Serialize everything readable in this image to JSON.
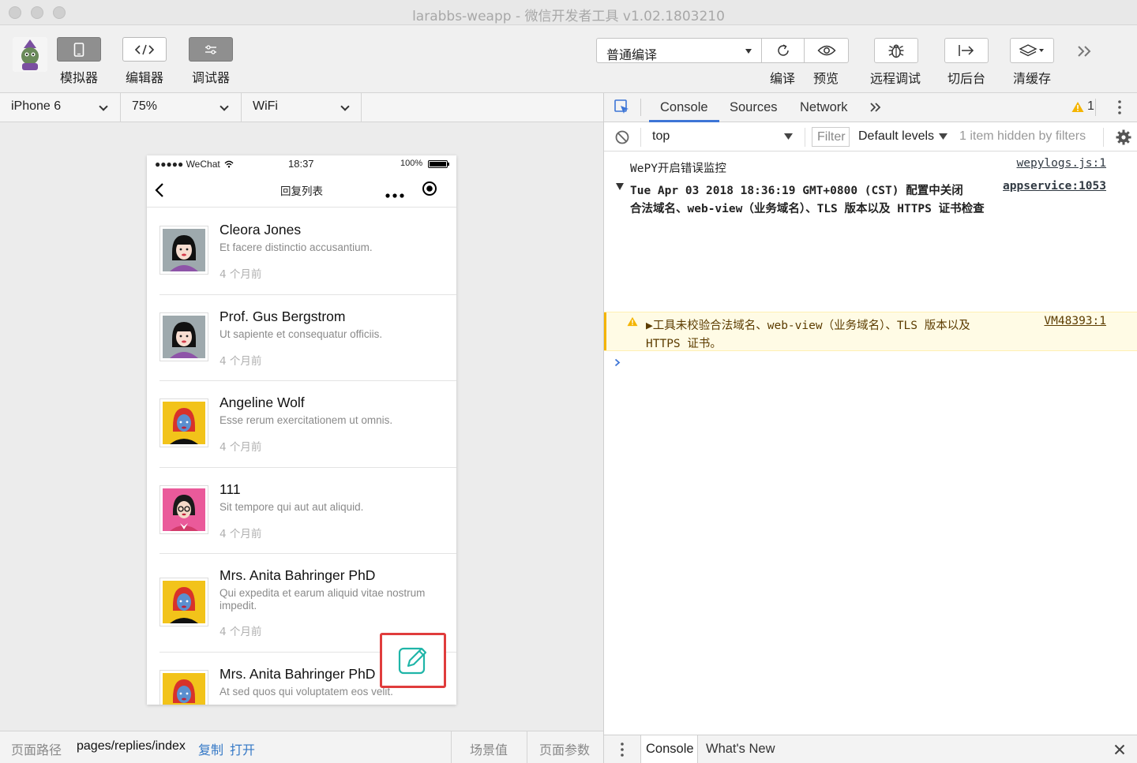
{
  "window": {
    "title": "larabbs-weapp - 微信开发者工具 v1.02.1803210"
  },
  "toolbar": {
    "simulator_label": "模拟器",
    "editor_label": "编辑器",
    "debugger_label": "调试器",
    "compile_mode": "普通编译",
    "compile_label": "编译",
    "preview_label": "预览",
    "remote_debug_label": "远程调试",
    "background_label": "切后台",
    "clear_cache_label": "清缓存"
  },
  "device_bar": {
    "device": "iPhone 6",
    "zoom": "75%",
    "network": "WiFi"
  },
  "phone": {
    "status": {
      "carrier": "●●●●● WeChat",
      "time": "18:37",
      "battery": "100%"
    },
    "nav_title": "回复列表",
    "items": [
      {
        "name": "Cleora Jones",
        "body": "Et facere distinctio accusantium.",
        "time": "4 个月前",
        "avatar": "woman-gray"
      },
      {
        "name": "Prof. Gus Bergstrom",
        "body": "Ut sapiente et consequatur officiis.",
        "time": "4 个月前",
        "avatar": "woman-gray"
      },
      {
        "name": "Angeline Wolf",
        "body": "Esse rerum exercitationem ut omnis.",
        "time": "4 个月前",
        "avatar": "woman-yellow"
      },
      {
        "name": "111",
        "body": "Sit tempore qui aut aut aliquid.",
        "time": "4 个月前",
        "avatar": "woman-pink"
      },
      {
        "name": "Mrs. Anita Bahringer PhD",
        "body": "Qui expedita et earum aliquid vitae nostrum impedit.",
        "time": "4 个月前",
        "avatar": "woman-yellow"
      },
      {
        "name": "Mrs. Anita Bahringer PhD",
        "body": "At sed quos qui voluptatem eos velit.",
        "time": "",
        "avatar": "woman-yellow"
      }
    ]
  },
  "footer": {
    "path_label": "页面路径",
    "path_value": "pages/replies/index",
    "copy_label": "复制",
    "open_label": "打开",
    "scene_label": "场景值",
    "params_label": "页面参数"
  },
  "devtools": {
    "tabs": [
      "Console",
      "Sources",
      "Network"
    ],
    "warning_count": "1",
    "context": "top",
    "filter_placeholder": "Filter",
    "levels": "Default levels",
    "hidden_note": "1 item hidden by filters",
    "logs": {
      "line1_text": "WePY开启错误监控",
      "line1_src": "wepylogs.js:1",
      "line2_text": "Tue Apr 03 2018 18:36:19 GMT+0800 (CST) 配置中关闭",
      "line2_text2": "合法域名、web-view（业务域名）、TLS 版本以及 HTTPS 证书检查",
      "line2_src": "appservice:1053",
      "warn_text": "▶工具未校验合法域名、web-view（业务域名）、TLS 版本以及",
      "warn_text2": "HTTPS 证书。",
      "warn_src": "VM48393:1"
    },
    "drawer_tabs": [
      "Console",
      "What's New"
    ]
  },
  "colors": {
    "accent_blue": "#1a73e8",
    "warn_bg": "#fffbe5",
    "fab_border": "#e03c3c",
    "fab_icon": "#1fb5a8"
  }
}
